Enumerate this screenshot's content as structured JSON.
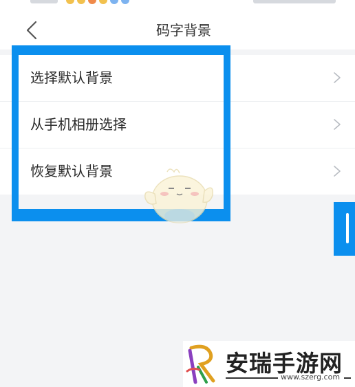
{
  "header": {
    "title": "码字背景"
  },
  "menu": {
    "items": [
      {
        "label": "选择默认背景",
        "icon": "chevron-right-icon"
      },
      {
        "label": "从手机相册选择",
        "icon": "chevron-right-icon"
      },
      {
        "label": "恢复默认背景",
        "icon": "chevron-right-icon"
      }
    ]
  },
  "watermark": {
    "brand": "安瑞手游网",
    "url": "www.szerg.com"
  },
  "colors": {
    "highlight": "#0b8fee",
    "background": "#f3f4f6",
    "surface": "#ffffff",
    "text": "#2b2b2b",
    "chevron": "#b8bcc2"
  }
}
